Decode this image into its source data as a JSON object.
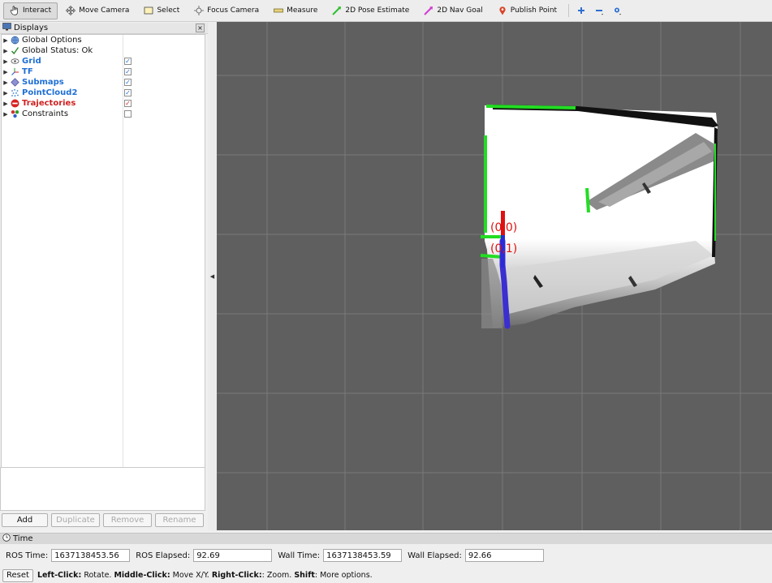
{
  "toolbar": {
    "tools": [
      {
        "label": "Interact",
        "icon": "hand-pointer-icon",
        "active": true
      },
      {
        "label": "Move Camera",
        "icon": "move-camera-icon",
        "active": false
      },
      {
        "label": "Select",
        "icon": "select-box-icon",
        "active": false
      },
      {
        "label": "Focus Camera",
        "icon": "focus-camera-icon",
        "active": false
      },
      {
        "label": "Measure",
        "icon": "ruler-icon",
        "active": false
      },
      {
        "label": "2D Pose Estimate",
        "icon": "pose-estimate-arrow-icon",
        "active": false
      },
      {
        "label": "2D Nav Goal",
        "icon": "nav-goal-arrow-icon",
        "active": false
      },
      {
        "label": "Publish Point",
        "icon": "map-pin-icon",
        "active": false
      }
    ],
    "extra_icons": [
      "add-tool-icon",
      "remove-tool-icon",
      "view-options-icon"
    ]
  },
  "displays_panel": {
    "title": "Displays",
    "close_label": "×",
    "items": [
      {
        "label": "Global Options",
        "icon": "globe-icon",
        "style": "normal",
        "checkbox": null
      },
      {
        "label": "Global Status: Ok",
        "icon": "checkmark-icon",
        "style": "normal",
        "checkbox": null
      },
      {
        "label": "Grid",
        "icon": "grid-eye-icon",
        "style": "blue",
        "checkbox": "✓"
      },
      {
        "label": "TF",
        "icon": "tf-axes-icon",
        "style": "blue",
        "checkbox": "✓"
      },
      {
        "label": "Submaps",
        "icon": "submaps-diamond-icon",
        "style": "blue",
        "checkbox": "✓"
      },
      {
        "label": "PointCloud2",
        "icon": "pointcloud-icon",
        "style": "blue",
        "checkbox": "✓"
      },
      {
        "label": "Trajectories",
        "icon": "error-stop-icon",
        "style": "red",
        "checkbox": "✓"
      },
      {
        "label": "Constraints",
        "icon": "constraints-dots-icon",
        "style": "normal",
        "checkbox": ""
      }
    ],
    "buttons": {
      "add": "Add",
      "duplicate": "Duplicate",
      "remove": "Remove",
      "rename": "Rename"
    }
  },
  "viewport": {
    "frame_labels": [
      "(0,0)",
      "(0,1)"
    ]
  },
  "time_panel": {
    "title": "Time",
    "ros_time_label": "ROS Time:",
    "ros_time": "1637138453.56",
    "ros_elapsed_label": "ROS Elapsed:",
    "ros_elapsed": "92.69",
    "wall_time_label": "Wall Time:",
    "wall_time": "1637138453.59",
    "wall_elapsed_label": "Wall Elapsed:",
    "wall_elapsed": "92.66"
  },
  "status_bar": {
    "reset_label": "Reset",
    "left_click_key": "Left-Click:",
    "left_click_text": " Rotate. ",
    "middle_click_key": "Middle-Click:",
    "middle_click_text": " Move X/Y. ",
    "right_click_key": "Right-Click:",
    "right_click_text": ": Zoom. ",
    "shift_key": "Shift",
    "shift_text": ": More options."
  },
  "colors": {
    "viewport_bg": "#5f5f5f",
    "blue_display": "#1f6fd6",
    "red_display": "#d02020",
    "scan_wall_green": "#22dd22",
    "trajectory_blue": "#3b2fd0",
    "frame_red": "#e01010"
  }
}
